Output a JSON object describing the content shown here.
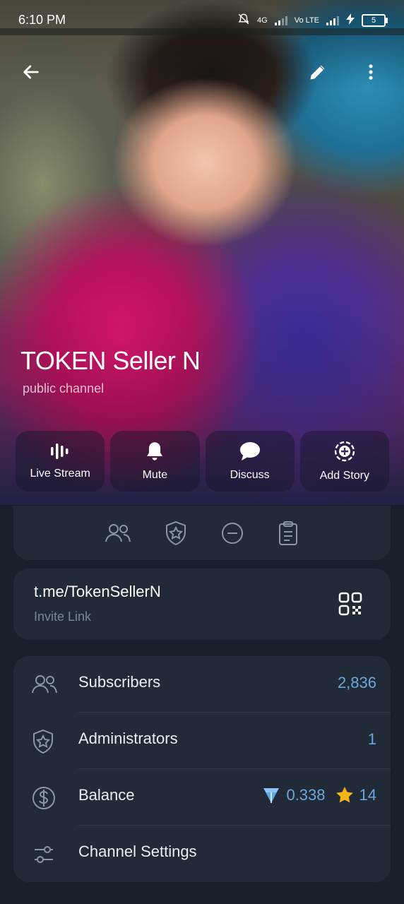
{
  "status_bar": {
    "time": "6:10 PM",
    "network_1": "4G",
    "network_2": "Vo LTE",
    "battery": "5"
  },
  "channel": {
    "title": "TOKEN Seller N",
    "subtitle": "public channel"
  },
  "actions": [
    {
      "label": "Live Stream",
      "icon": "live-stream-icon"
    },
    {
      "label": "Mute",
      "icon": "bell-icon"
    },
    {
      "label": "Discuss",
      "icon": "chat-bubble-icon"
    },
    {
      "label": "Add Story",
      "icon": "add-story-icon"
    }
  ],
  "quick_icons": [
    "people-icon",
    "shield-star-icon",
    "minus-circle-icon",
    "clipboard-icon"
  ],
  "invite": {
    "url": "t.me/TokenSellerN",
    "caption": "Invite Link"
  },
  "list": {
    "subscribers": {
      "label": "Subscribers",
      "value": "2,836"
    },
    "administrators": {
      "label": "Administrators",
      "value": "1"
    },
    "balance": {
      "label": "Balance",
      "ton": "0.338",
      "stars": "14"
    },
    "settings": {
      "label": "Channel Settings"
    }
  },
  "colors": {
    "background": "#17202b",
    "card": "#212b37",
    "accent": "#6aa7dd",
    "star": "#f5b41a"
  }
}
